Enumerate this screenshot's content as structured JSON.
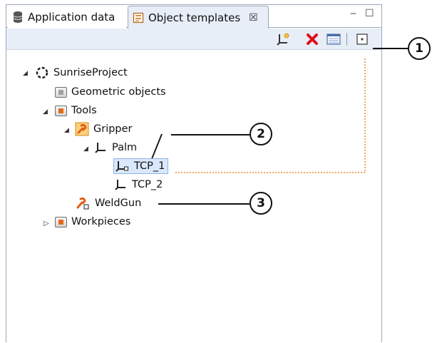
{
  "tabs": [
    {
      "label": "Application data",
      "icon": "database-icon",
      "active": false
    },
    {
      "label": "Object templates",
      "icon": "template-icon",
      "active": true
    }
  ],
  "window_controls": {
    "minimize": "‒",
    "maximize": "☐"
  },
  "toolbar": {
    "buttons": [
      "new-frame-icon",
      "delete-icon",
      "properties-icon",
      "link-with-editor-icon"
    ]
  },
  "tree": {
    "root": "SunriseProject",
    "geometric": "Geometric objects",
    "tools": "Tools",
    "gripper": "Gripper",
    "palm": "Palm",
    "tcp1": "TCP_1",
    "tcp2": "TCP_2",
    "weldgun": "WeldGun",
    "workpieces": "Workpieces"
  },
  "callouts": [
    "1",
    "2",
    "3"
  ],
  "colors": {
    "selection": "#d9e8fb",
    "accent_orange": "#e06a1a",
    "delete_red": "#e0101a",
    "callout_dotted": "#f08a2c"
  }
}
